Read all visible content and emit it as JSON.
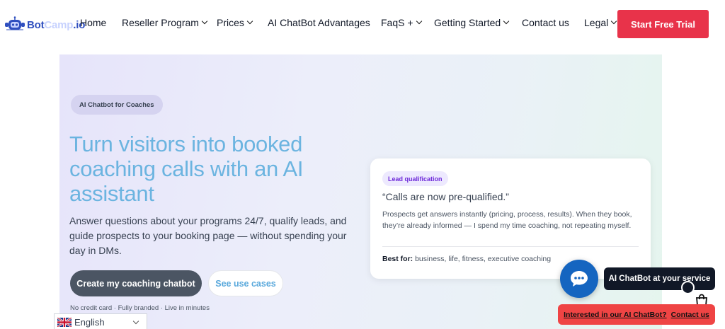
{
  "header": {
    "logo": {
      "part1": "Bot",
      "part2": "Camp",
      "part3": ".io"
    },
    "nav": [
      {
        "label": "Home",
        "dropdown": false
      },
      {
        "label": "Reseller Program",
        "dropdown": true
      },
      {
        "label": "Prices",
        "dropdown": true
      },
      {
        "label": "AI ChatBot Advantages",
        "dropdown": false
      },
      {
        "label": "FaqS +",
        "dropdown": true
      },
      {
        "label": "Getting Started",
        "dropdown": true
      },
      {
        "label": "Contact us",
        "dropdown": false
      },
      {
        "label": "Legal",
        "dropdown": true
      }
    ],
    "cta_label": "Start Free Trial"
  },
  "hero": {
    "badge": "AI Chatbot for Coaches",
    "headline": "Turn visitors into booked coaching calls with an AI assistant",
    "subtext": "Answer questions about your programs 24/7, qualify leads, and guide prospects to your booking page — without spending your day in DMs.",
    "primary_button": "Create my coaching chatbot",
    "secondary_button": "See use cases",
    "fineprint": "No credit card · Fully branded · Live in minutes"
  },
  "card": {
    "pill": "Lead qualification",
    "quote": "“Calls are now pre-qualified.”",
    "body": "Prospects get answers instantly (pricing, process, results). When they book, they’re already informed — I spend my time coaching, not repeating myself.",
    "best_for_label": "Best for:",
    "best_for_value": "business, life, fitness, executive coaching"
  },
  "widgets": {
    "tooltip": "AI ChatBot at your service",
    "interest_text": "Interested in our AI ChatBot?",
    "contact_text": "Contact us",
    "language": "English"
  },
  "colors": {
    "accent_red": "#e8334a",
    "headline_blue": "#6bb4e0",
    "chat_blue": "#1565c0"
  }
}
